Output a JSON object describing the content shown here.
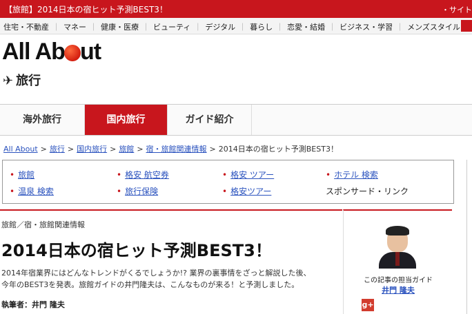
{
  "topbar": {
    "promo": "【旅館】2014日本の宿ヒット予測BEST3！",
    "right": "・サイト"
  },
  "categories": [
    "住宅・不動産",
    "マネー",
    "健康・医療",
    "ビューティ",
    "デジタル",
    "暮らし",
    "恋愛・結婚",
    "ビジネス・学習",
    "メンズスタイル"
  ],
  "logo": {
    "left": "All Ab",
    "right": "ut"
  },
  "section": {
    "icon": "airplane-icon",
    "label": "旅行"
  },
  "tabs": [
    "海外旅行",
    "国内旅行",
    "ガイド紹介"
  ],
  "breadcrumb": [
    "All About",
    "旅行",
    "国内旅行",
    "旅館",
    "宿・旅館関連情報",
    "2014日本の宿ヒット予測BEST3！"
  ],
  "links": {
    "row1": [
      "旅館",
      "格安 航空券",
      "格安 ツアー",
      "ホテル 検索"
    ],
    "row2": [
      "温泉 検索",
      "旅行保険",
      "格安ツアー"
    ],
    "sponsored": "スポンサード・リンク"
  },
  "article": {
    "category": "旅館／宿・旅館関連情報",
    "title": "2014日本の宿ヒット予測BEST3！",
    "desc_line1": "2014年宿業界にはどんなトレンドがくるでしょうか!? 業界の裏事情をざっと解説した後、",
    "desc_line2": "今年のBEST3を発表。旅館ガイドの井門隆夫は、こんなものが来る！と予測しました。",
    "author": "執筆者：井門 隆夫"
  },
  "guide": {
    "caption": "この記事の担当ガイド",
    "name": "井門 隆夫",
    "gplus": "g+"
  },
  "colors": {
    "accent": "#c8161d",
    "link": "#2a52be"
  }
}
